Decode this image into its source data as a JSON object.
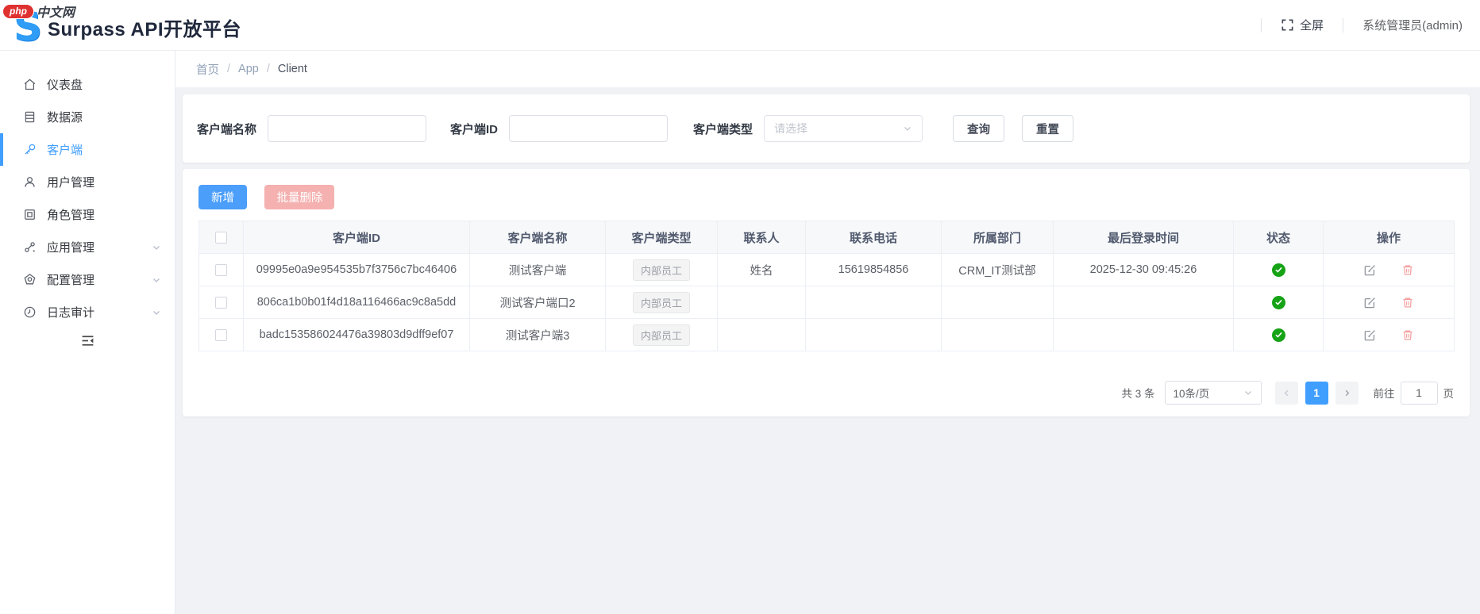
{
  "watermark": {
    "badge": "php",
    "site": "中文网"
  },
  "header": {
    "logo_letter": "S",
    "title": "Surpass API开放平台",
    "fullscreen_label": "全屏",
    "user_name": "系统管理员(admin)"
  },
  "sidebar": {
    "items": [
      {
        "label": "仪表盘",
        "icon": "home-icon",
        "active": false
      },
      {
        "label": "数据源",
        "icon": "datasource-icon",
        "active": false
      },
      {
        "label": "客户端",
        "icon": "key-icon",
        "active": true
      },
      {
        "label": "用户管理",
        "icon": "user-icon",
        "active": false
      },
      {
        "label": "角色管理",
        "icon": "role-icon",
        "active": false
      },
      {
        "label": "应用管理",
        "icon": "app-icon",
        "active": false,
        "expandable": true
      },
      {
        "label": "配置管理",
        "icon": "config-icon",
        "active": false,
        "expandable": true
      },
      {
        "label": "日志审计",
        "icon": "clock-icon",
        "active": false,
        "expandable": true
      }
    ]
  },
  "breadcrumb": {
    "home": "首页",
    "section": "App",
    "current": "Client",
    "separator": "/"
  },
  "filters": {
    "name_label": "客户端名称",
    "name_value": "",
    "id_label": "客户端ID",
    "id_value": "",
    "type_label": "客户端类型",
    "type_placeholder": "请选择",
    "query_button": "查询",
    "reset_button": "重置"
  },
  "toolbar": {
    "add_button": "新增",
    "batch_delete_button": "批量删除"
  },
  "table": {
    "columns": [
      "客户端ID",
      "客户端名称",
      "客户端类型",
      "联系人",
      "联系电话",
      "所属部门",
      "最后登录时间",
      "状态",
      "操作"
    ],
    "rows": [
      {
        "client_id": "09995e0a9e954535b7f3756c7bc46406",
        "name": "测试客户端",
        "type_tag": "内部员工",
        "contact": "姓名",
        "phone": "15619854856",
        "department": "CRM_IT测试部",
        "last_login": "2025-12-30 09:45:26",
        "status": "enabled"
      },
      {
        "client_id": "806ca1b0b01f4d18a116466ac9c8a5dd",
        "name": "测试客户端口2",
        "type_tag": "内部员工",
        "contact": "",
        "phone": "",
        "department": "",
        "last_login": "",
        "status": "enabled"
      },
      {
        "client_id": "badc153586024476a39803d9dff9ef07",
        "name": "测试客户端3",
        "type_tag": "内部员工",
        "contact": "",
        "phone": "",
        "department": "",
        "last_login": "",
        "status": "enabled"
      }
    ]
  },
  "pagination": {
    "total_text": "共 3 条",
    "page_size": "10条/页",
    "current_page": "1",
    "goto_label": "前往",
    "goto_value": "1",
    "page_unit": "页"
  },
  "colors": {
    "primary": "#409eff",
    "success_green": "#16a316",
    "danger_disabled": "#f5b0b0",
    "tag_text": "#909399",
    "header_bg": "#ffffff",
    "content_bg": "#f0f2f5"
  }
}
